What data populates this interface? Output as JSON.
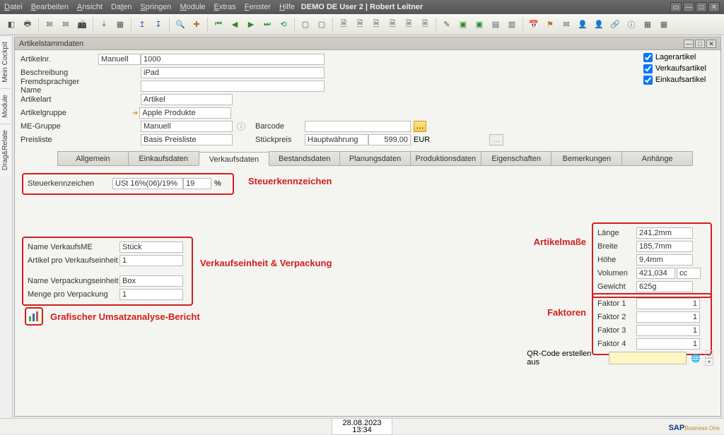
{
  "menu": {
    "items": [
      "Datei",
      "Bearbeiten",
      "Ansicht",
      "Daten",
      "Springen",
      "Module",
      "Extras",
      "Fenster",
      "Hilfe"
    ]
  },
  "title": "DEMO DE User 2 | Robert Leitner",
  "sidetabs": [
    "Mein Cockpit",
    "Module",
    "Drag&Relate"
  ],
  "panel_title": "Artikelstammdaten",
  "header": {
    "artikelnr_label": "Artikelnr.",
    "artikelnr_mode": "Manuell",
    "artikelnr_value": "1000",
    "beschreibung_label": "Beschreibung",
    "beschreibung_value": "iPad",
    "fremd_label": "Fremdsprachiger Name",
    "fremd_value": "",
    "artikelart_label": "Artikelart",
    "artikelart_value": "Artikel",
    "artikelgruppe_label": "Artikelgruppe",
    "artikelgruppe_value": "Apple Produkte",
    "megruppe_label": "ME-Gruppe",
    "megruppe_value": "Manuell",
    "preisliste_label": "Preisliste",
    "preisliste_value": "Basis Preisliste",
    "barcode_label": "Barcode",
    "barcode_value": "",
    "stueckpreis_label": "Stückpreis",
    "stueckpreis_currency": "Hauptwährung",
    "stueckpreis_value": "599,00",
    "stueckpreis_unit": "EUR",
    "chk_lager": "Lagerartikel",
    "chk_verkauf": "Verkaufsartikel",
    "chk_einkauf": "Einkaufsartikel"
  },
  "tabs": [
    "Allgemein",
    "Einkaufsdaten",
    "Verkaufsdaten",
    "Bestandsdaten",
    "Planungsdaten",
    "Produktionsdaten",
    "Eigenschaften",
    "Bemerkungen",
    "Anhänge"
  ],
  "steuer": {
    "label": "Steuerkennzeichen",
    "value": "USt 16%(06)/19%",
    "percent": "19",
    "percent_suffix": "%",
    "annotation": "Steuerkennzeichen"
  },
  "verkauf": {
    "name_me_label": "Name VerkaufsME",
    "name_me_value": "Stück",
    "art_pro_label": "Artikel pro Verkaufseinheit",
    "art_pro_value": "1",
    "name_vp_label": "Name Verpackungseinheit",
    "name_vp_value": "Box",
    "menge_vp_label": "Menge pro Verpackung",
    "menge_vp_value": "1",
    "annotation": "Verkaufseinheit & Verpackung"
  },
  "chart": {
    "annotation": "Grafischer Umsatzanalyse-Bericht"
  },
  "masse": {
    "annotation": "Artikelmaße",
    "laenge_label": "Länge",
    "laenge_value": "241,2mm",
    "breite_label": "Breite",
    "breite_value": "185,7mm",
    "hoehe_label": "Höhe",
    "hoehe_value": "9,4mm",
    "volumen_label": "Volumen",
    "volumen_value": "421,034",
    "volumen_unit": "cc",
    "gewicht_label": "Gewicht",
    "gewicht_value": "625g"
  },
  "faktor": {
    "annotation": "Faktoren",
    "f1_label": "Faktor 1",
    "f1_value": "1",
    "f2_label": "Faktor 2",
    "f2_value": "1",
    "f3_label": "Faktor 3",
    "f3_value": "1",
    "f4_label": "Faktor 4",
    "f4_value": "1"
  },
  "qr": {
    "label": "QR-Code erstellen aus",
    "value": ""
  },
  "status": {
    "date": "28.08.2023",
    "time": "13:34"
  },
  "logo": {
    "main": "SAP",
    "sub": "Business One"
  }
}
